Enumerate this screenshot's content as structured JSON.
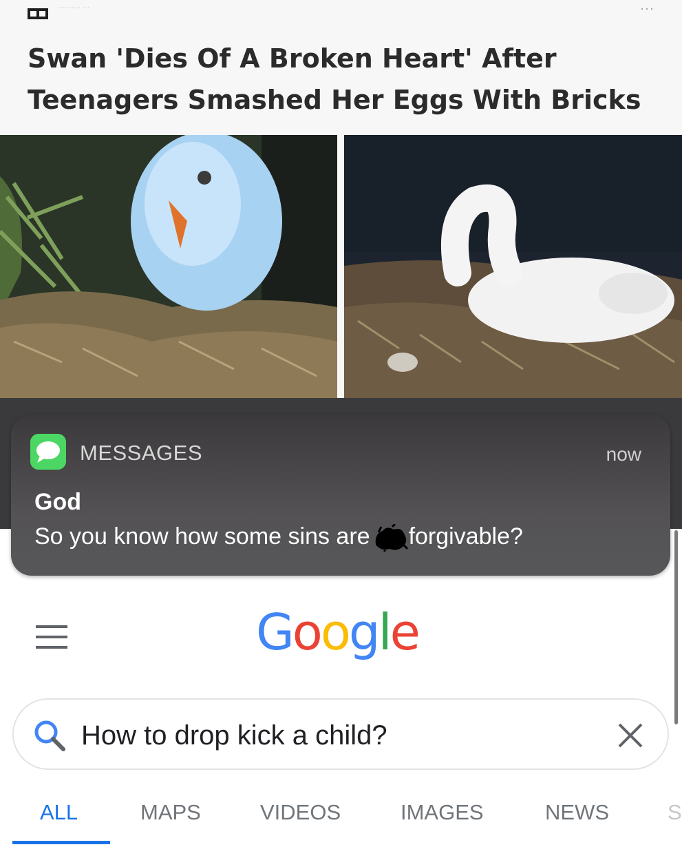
{
  "article": {
    "source_meta": "··········  ···",
    "more_menu": "···",
    "headline_line1": "Swan 'Dies Of A Broken Heart' After",
    "headline_line2": "Teenagers Smashed Her Eggs With Bricks"
  },
  "notification": {
    "app_name": "MESSAGES",
    "time": "now",
    "sender": "God",
    "body_before": "So you know how some sins are",
    "body_after": "forgivable?"
  },
  "google": {
    "logo_letters": [
      {
        "char": "G",
        "color": "#4285F4"
      },
      {
        "char": "o",
        "color": "#EA4335"
      },
      {
        "char": "o",
        "color": "#FBBC05"
      },
      {
        "char": "g",
        "color": "#4285F4"
      },
      {
        "char": "l",
        "color": "#34A853"
      },
      {
        "char": "e",
        "color": "#EA4335"
      }
    ],
    "search_query": "How to drop kick a child?",
    "tabs": [
      "ALL",
      "MAPS",
      "VIDEOS",
      "IMAGES",
      "NEWS",
      "S"
    ],
    "active_tab": "ALL",
    "accent_color": "#1a73e8"
  }
}
